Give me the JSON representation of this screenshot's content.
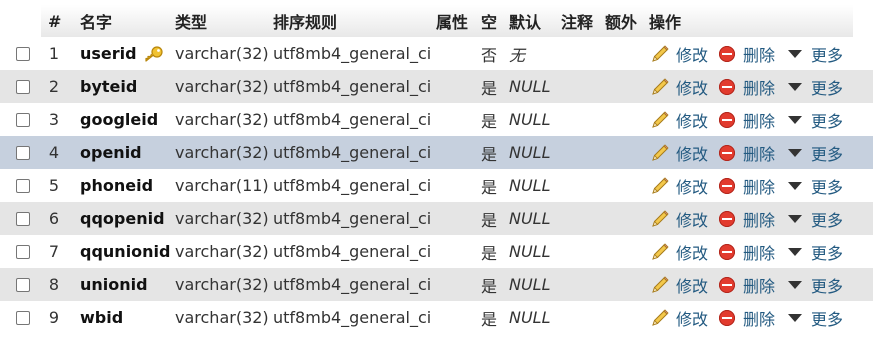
{
  "headers": {
    "num": "#",
    "name": "名字",
    "type": "类型",
    "collation": "排序规则",
    "attributes": "属性",
    "null": "空",
    "default": "默认",
    "comment": "注释",
    "extra": "额外",
    "action": "操作"
  },
  "actions": {
    "edit": "修改",
    "delete": "删除",
    "more": "更多"
  },
  "icons": {
    "key": "key-icon",
    "edit": "pencil-icon",
    "delete": "delete-icon",
    "more": "dropdown-arrow-icon"
  },
  "rows": [
    {
      "num": "1",
      "name": "userid",
      "type": "varchar(32)",
      "collation": "utf8mb4_general_ci",
      "null": "否",
      "default": "无",
      "primary_key": true
    },
    {
      "num": "2",
      "name": "byteid",
      "type": "varchar(32)",
      "collation": "utf8mb4_general_ci",
      "null": "是",
      "default": "NULL"
    },
    {
      "num": "3",
      "name": "googleid",
      "type": "varchar(32)",
      "collation": "utf8mb4_general_ci",
      "null": "是",
      "default": "NULL"
    },
    {
      "num": "4",
      "name": "openid",
      "type": "varchar(32)",
      "collation": "utf8mb4_general_ci",
      "null": "是",
      "default": "NULL",
      "highlighted": true
    },
    {
      "num": "5",
      "name": "phoneid",
      "type": "varchar(11)",
      "collation": "utf8mb4_general_ci",
      "null": "是",
      "default": "NULL"
    },
    {
      "num": "6",
      "name": "qqopenid",
      "type": "varchar(32)",
      "collation": "utf8mb4_general_ci",
      "null": "是",
      "default": "NULL"
    },
    {
      "num": "7",
      "name": "qqunionid",
      "type": "varchar(32)",
      "collation": "utf8mb4_general_ci",
      "null": "是",
      "default": "NULL"
    },
    {
      "num": "8",
      "name": "unionid",
      "type": "varchar(32)",
      "collation": "utf8mb4_general_ci",
      "null": "是",
      "default": "NULL"
    },
    {
      "num": "9",
      "name": "wbid",
      "type": "varchar(32)",
      "collation": "utf8mb4_general_ci",
      "null": "是",
      "default": "NULL"
    }
  ]
}
